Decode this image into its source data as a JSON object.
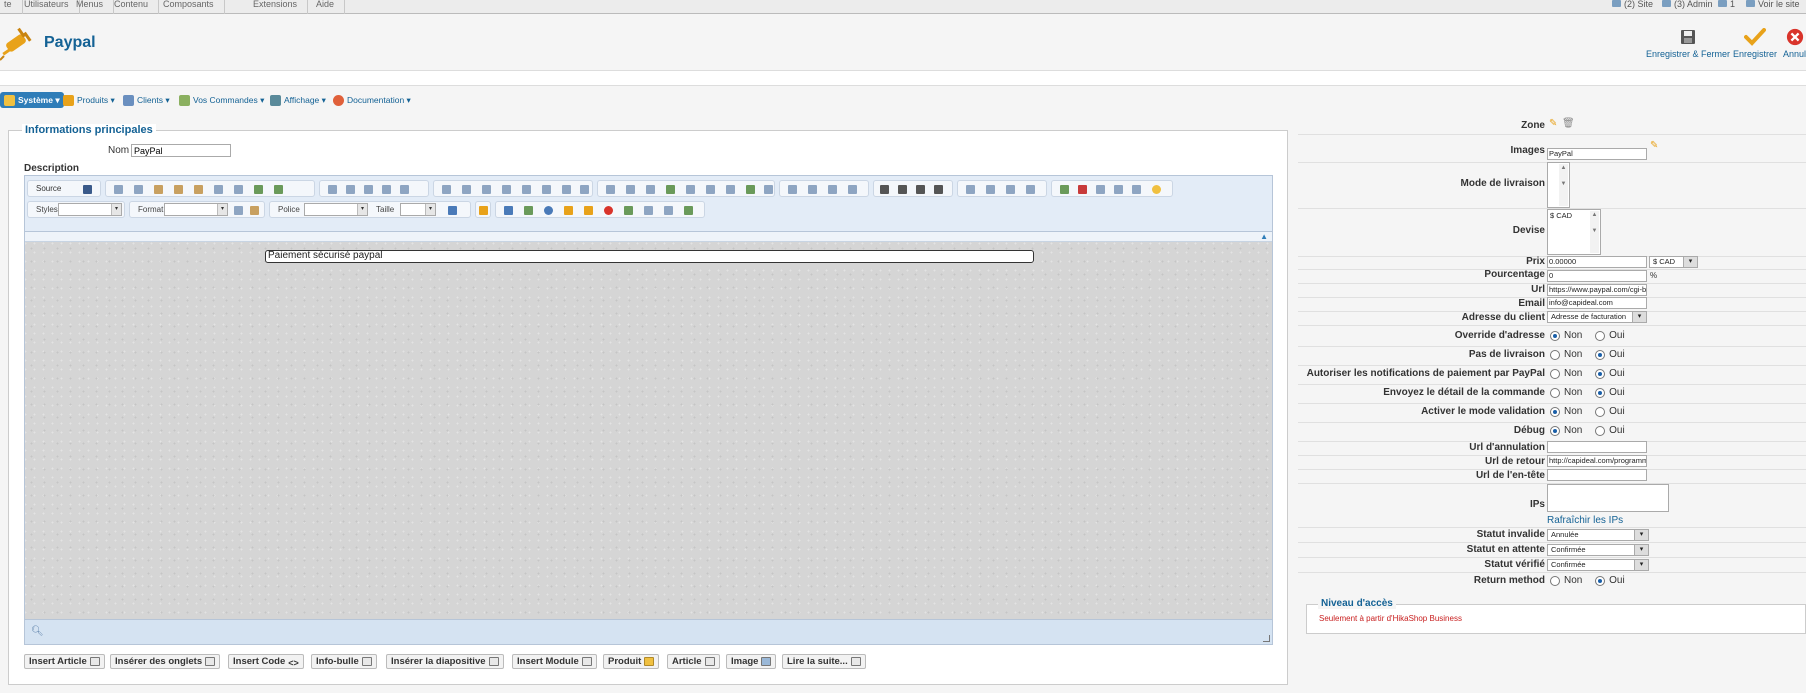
{
  "topmenu": {
    "items": [
      "te",
      "Utilisateurs",
      "Menus",
      "Contenu",
      "Composants",
      "Extensions",
      "Aide"
    ],
    "right": [
      "(2) Site",
      "(3) Admin",
      "1",
      "Voir le site"
    ]
  },
  "header": {
    "title": "Paypal",
    "toolbar": {
      "save_close": "Enregistrer & Fermer",
      "save": "Enregistrer",
      "cancel": "Annul"
    }
  },
  "hikamenu": [
    "Système",
    "Produits",
    "Clients",
    "Vos Commandes",
    "Affichage",
    "Documentation"
  ],
  "form": {
    "legend": "Informations principales",
    "nom_label": "Nom",
    "nom_value": "PayPal",
    "description_label": "Description"
  },
  "editor": {
    "source_label": "Source",
    "styles_label": "Styles",
    "format_label": "Format",
    "police_label": "Police",
    "taille_label": "Taille",
    "content": "Paiement sécurisé paypal"
  },
  "editor_buttons": [
    "Insert Article",
    "Insérer des onglets",
    "Insert Code",
    "Info-bulle",
    "Insérer la diapositive",
    "Insert Module",
    "Produit",
    "Article",
    "Image",
    "Lire la suite..."
  ],
  "params": {
    "zone_label": "Zone",
    "images_label": "Images",
    "images_value": "PayPal",
    "mode_livraison_label": "Mode de livraison",
    "devise_label": "Devise",
    "devise_value": "$ CAD",
    "prix_label": "Prix",
    "prix_value": "0.00000",
    "prix_currency": "$ CAD",
    "pourcentage_label": "Pourcentage",
    "pourcentage_value": "0",
    "pourcentage_unit": "%",
    "url_label": "Url",
    "url_value": "https://www.paypal.com/cgi-bi",
    "email_label": "Email",
    "email_value": "info@capideal.com",
    "adresse_client_label": "Adresse du client",
    "adresse_client_value": "Adresse de facturation",
    "override_label": "Override d'adresse",
    "pas_livraison_label": "Pas de livraison",
    "autoriser_label": "Autoriser les notifications de paiement par PayPal",
    "envoyez_label": "Envoyez le détail de la commande",
    "activer_label": "Activer le mode validation",
    "debug_label": "Débug",
    "non": "Non",
    "oui": "Oui",
    "url_annulation_label": "Url d'annulation",
    "url_retour_label": "Url de retour",
    "url_retour_value": "http://capideal.com/programm",
    "url_entete_label": "Url de l'en-tête",
    "ips_label": "IPs",
    "refresh_ips": "Rafraîchir les IPs",
    "statut_invalide_label": "Statut invalide",
    "statut_invalide_value": "Annulée",
    "statut_attente_label": "Statut en attente",
    "statut_attente_value": "Confirmée",
    "statut_verifie_label": "Statut vérifié",
    "statut_verifie_value": "Confirmée",
    "return_method_label": "Return method",
    "radios": {
      "override": "non",
      "pas_livraison": "oui",
      "autoriser": "oui",
      "envoyez": "oui",
      "activer": "non",
      "debug": "non",
      "return_method": "oui"
    }
  },
  "niveau": {
    "legend": "Niveau d'accès",
    "text": "Seulement à partir d'HikaShop Business"
  },
  "colors": {
    "brand": "#146295",
    "menu_active": "#2f7db8",
    "save_check": "#e8a21a",
    "cancel_red": "#d9342b",
    "warning": "#c81e1e"
  }
}
